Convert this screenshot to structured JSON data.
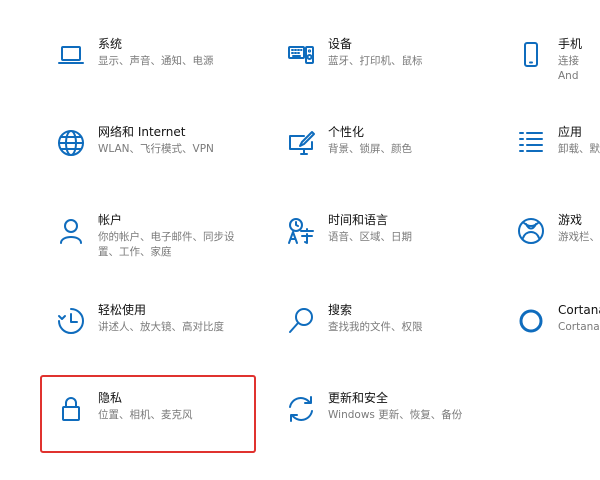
{
  "colors": {
    "icon": "#0f6cbd",
    "title": "#111111",
    "description": "#7a7a7a",
    "highlight": "#e0322f",
    "background": "#ffffff"
  },
  "tiles": [
    {
      "id": "system",
      "icon": "laptop-icon",
      "title": "系统",
      "desc": "显示、声音、通知、电源"
    },
    {
      "id": "devices",
      "icon": "keyboard-speaker-icon",
      "title": "设备",
      "desc": "蓝牙、打印机、鼠标"
    },
    {
      "id": "phone",
      "icon": "phone-icon",
      "title": "手机",
      "desc": "连接 And"
    },
    {
      "id": "network",
      "icon": "globe-icon",
      "title": "网络和 Internet",
      "desc": "WLAN、飞行模式、VPN"
    },
    {
      "id": "personalization",
      "icon": "paint-monitor-icon",
      "title": "个性化",
      "desc": "背景、锁屏、颜色"
    },
    {
      "id": "apps",
      "icon": "apps-list-icon",
      "title": "应用",
      "desc": "卸载、默"
    },
    {
      "id": "accounts",
      "icon": "person-icon",
      "title": "帐户",
      "desc": "你的帐户、电子邮件、同步设置、工作、家庭"
    },
    {
      "id": "time-language",
      "icon": "time-language-icon",
      "title": "时间和语言",
      "desc": "语音、区域、日期"
    },
    {
      "id": "gaming",
      "icon": "xbox-icon",
      "title": "游戏",
      "desc": "游戏栏、"
    },
    {
      "id": "ease-of-access",
      "icon": "ease-of-access-icon",
      "title": "轻松使用",
      "desc": "讲述人、放大镜、高对比度"
    },
    {
      "id": "search",
      "icon": "search-icon",
      "title": "搜索",
      "desc": "查找我的文件、权限"
    },
    {
      "id": "cortana",
      "icon": "cortana-ring-icon",
      "title": "Cortana",
      "desc": "Cortana"
    },
    {
      "id": "privacy",
      "icon": "lock-icon",
      "title": "隐私",
      "desc": "位置、相机、麦克风"
    },
    {
      "id": "update-security",
      "icon": "sync-arrows-icon",
      "title": "更新和安全",
      "desc": "Windows 更新、恢复、备份"
    }
  ]
}
